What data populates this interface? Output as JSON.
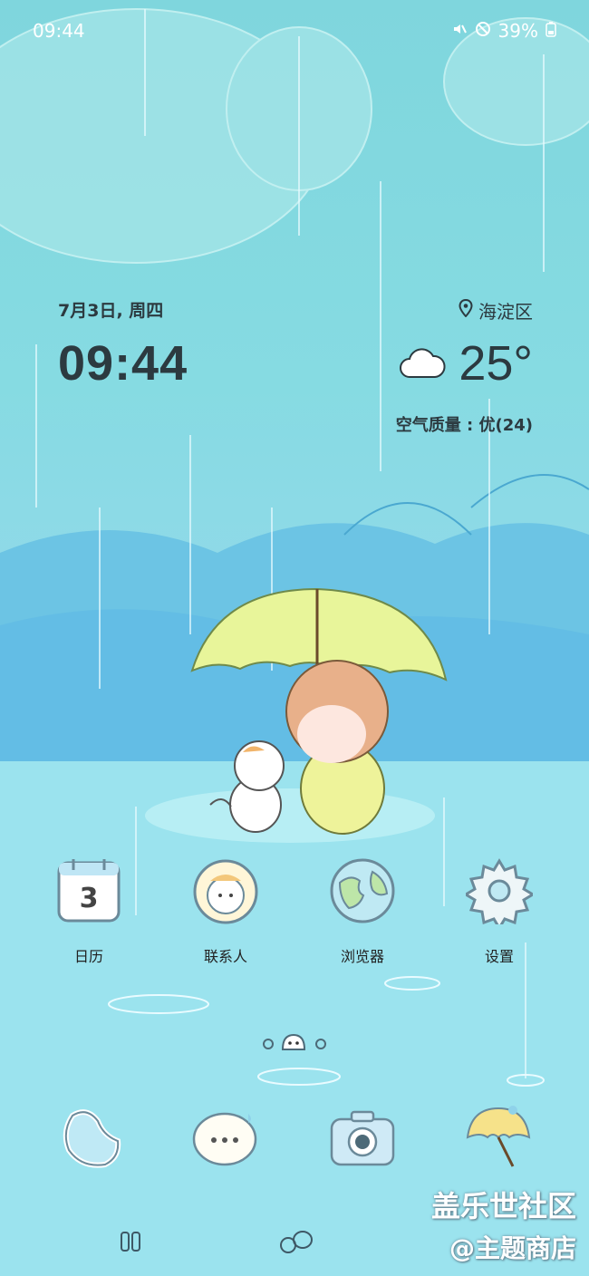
{
  "status_bar": {
    "time": "09:44",
    "battery": "39%"
  },
  "widget": {
    "date": "7月3日, 周四",
    "time": "09:44",
    "location": "海淀区",
    "temperature": "25°",
    "air_quality": "空气质量 : 优(24)"
  },
  "apps": [
    {
      "label": "日历",
      "day": "3"
    },
    {
      "label": "联系人"
    },
    {
      "label": "浏览器"
    },
    {
      "label": "设置"
    }
  ],
  "watermark": {
    "line1": "盖乐世社区",
    "line2": "@主题商店"
  },
  "colors": {
    "sky": "#7fd6dd",
    "umbrella": "#e8f59a",
    "text": "#2c3a40"
  }
}
